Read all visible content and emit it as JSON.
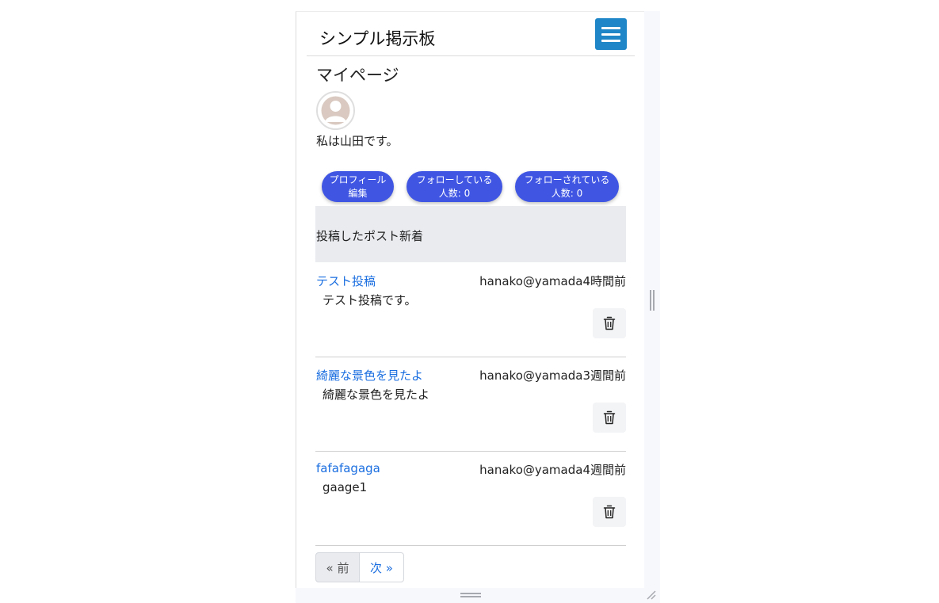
{
  "navbar": {
    "brand": "シンプル掲示板",
    "menu_icon": "hamburger-menu-icon",
    "menu_color": "#1f86c7"
  },
  "profile": {
    "title": "マイページ",
    "avatar_icon": "default-user-avatar-icon",
    "bio": "私は山田です。"
  },
  "actions": {
    "edit_profile": "プロフィール\n編集",
    "following": "フォローしている\n人数: 0",
    "followers": "フォローされている\n人数: 0",
    "accent": "#4056e3"
  },
  "posts_section": {
    "header": "投稿したポスト新着"
  },
  "posts": [
    {
      "title": "テスト投稿",
      "meta": "hanako@yamada4時間前",
      "body": "テスト投稿です。",
      "delete_icon": "trash-icon"
    },
    {
      "title": "綺麗な景色を見たよ",
      "meta": "hanako@yamada3週間前",
      "body": "綺麗な景色を見たよ",
      "delete_icon": "trash-icon"
    },
    {
      "title": "fafafagaga",
      "meta": "hanako@yamada4週間前",
      "body": "gaage1",
      "delete_icon": "trash-icon"
    }
  ],
  "pagination": {
    "prev": "« 前",
    "next": "次 »"
  }
}
